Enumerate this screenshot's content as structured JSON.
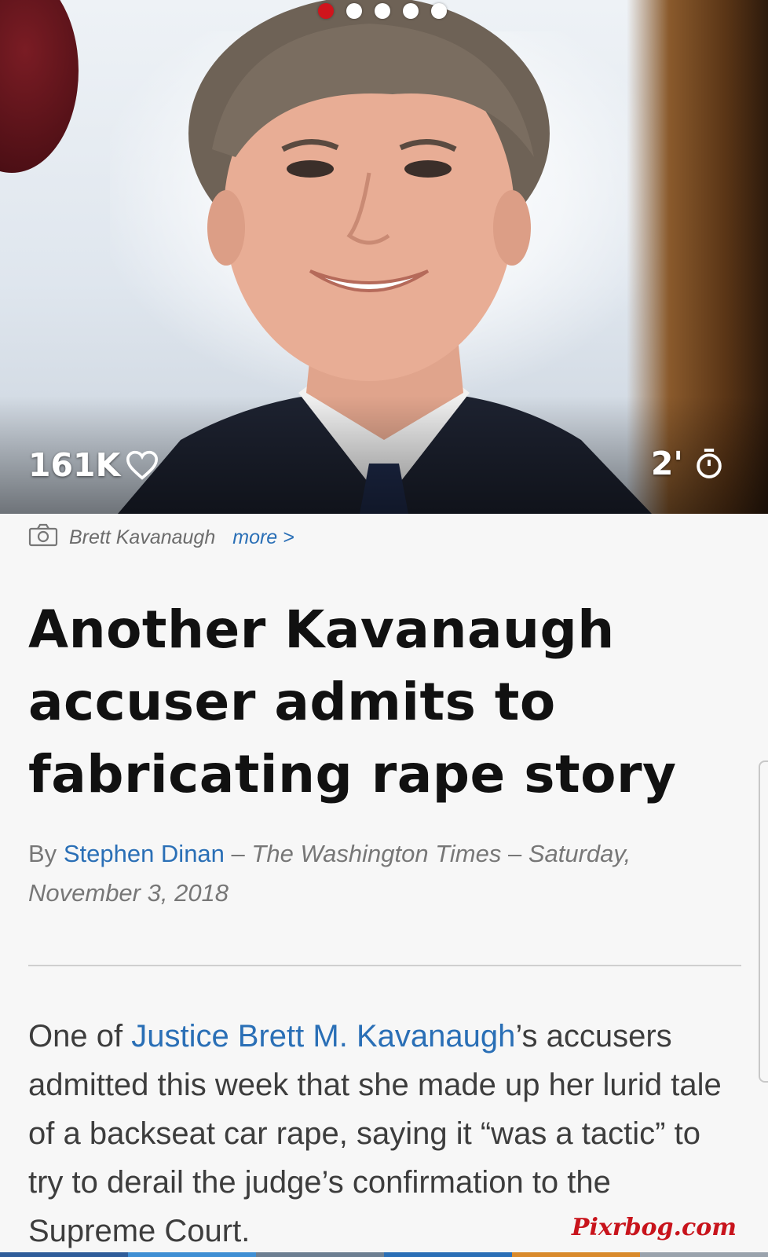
{
  "hero": {
    "image_alt": "Brett Kavanaugh",
    "carousel": {
      "total": 5,
      "active_index": 0
    },
    "likes_count": "161K",
    "likes_icon": "heart-outline-icon",
    "read_time": "2'",
    "read_time_icon": "stopwatch-icon",
    "colors": {
      "active_dot": "#d0141c",
      "inactive_dot": "#ffffff"
    }
  },
  "caption": {
    "icon": "camera-icon",
    "text": "Brett Kavanaugh",
    "more_label": "more >"
  },
  "headline": "Another Kavanaugh accuser admits to fabricating rape story",
  "byline": {
    "prefix": "By",
    "author": "Stephen Dinan",
    "separator1": "–",
    "publication": "The Washington Times",
    "separator2": "–",
    "date": "Saturday, November 3, 2018"
  },
  "body": {
    "intro": "One of",
    "link_text": "Justice Brett M. Kavanaugh",
    "rest": "’s accusers admitted this week that she made up her lurid tale of a backseat car rape, saying it “was a tactic” to try to derail the judge’s confirmation to the Supreme Court."
  },
  "watermark": "Pixrbog.com",
  "colors": {
    "link": "#2a6fb6",
    "headline": "#111111",
    "body": "#3d3d3d",
    "watermark": "#c8141c"
  },
  "bottom_strip_colors": [
    "#2f5d9a",
    "#3f8fd4",
    "#6d7f92",
    "#2a6fb6",
    "#d98a2b",
    "#9aa3ad"
  ]
}
